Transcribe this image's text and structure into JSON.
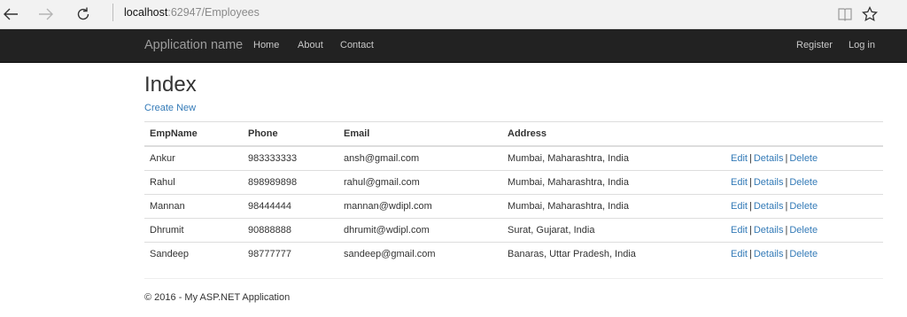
{
  "browser": {
    "url_host": "localhost",
    "url_rest": ":62947/Employees"
  },
  "navbar": {
    "brand": "Application name",
    "links": [
      "Home",
      "About",
      "Contact"
    ],
    "right_links": [
      "Register",
      "Log in"
    ]
  },
  "page": {
    "title": "Index",
    "create_link": "Create New"
  },
  "table": {
    "headers": [
      "EmpName",
      "Phone",
      "Email",
      "Address"
    ],
    "rows": [
      {
        "name": "Ankur",
        "phone": "983333333",
        "email": "ansh@gmail.com",
        "address": "Mumbai, Maharashtra, India"
      },
      {
        "name": "Rahul",
        "phone": "898989898",
        "email": "rahul@gmail.com",
        "address": "Mumbai, Maharashtra, India"
      },
      {
        "name": "Mannan",
        "phone": "98444444",
        "email": "mannan@wdipl.com",
        "address": "Mumbai, Maharashtra, India"
      },
      {
        "name": "Dhrumit",
        "phone": "90888888",
        "email": "dhrumit@wdipl.com",
        "address": "Surat, Gujarat, India"
      },
      {
        "name": "Sandeep",
        "phone": "98777777",
        "email": "sandeep@gmail.com",
        "address": "Banaras, Uttar Pradesh, India"
      }
    ],
    "actions": {
      "edit": "Edit",
      "details": "Details",
      "delete": "Delete",
      "separator": "|"
    }
  },
  "footer": {
    "text": "© 2016 - My ASP.NET Application"
  },
  "icons": {
    "back": "back-arrow-icon",
    "forward": "forward-arrow-icon",
    "refresh": "refresh-icon",
    "reading_view": "reading-view-icon",
    "favorite": "star-icon"
  },
  "colors": {
    "navbar_bg": "#222222",
    "link": "#337ab7"
  }
}
